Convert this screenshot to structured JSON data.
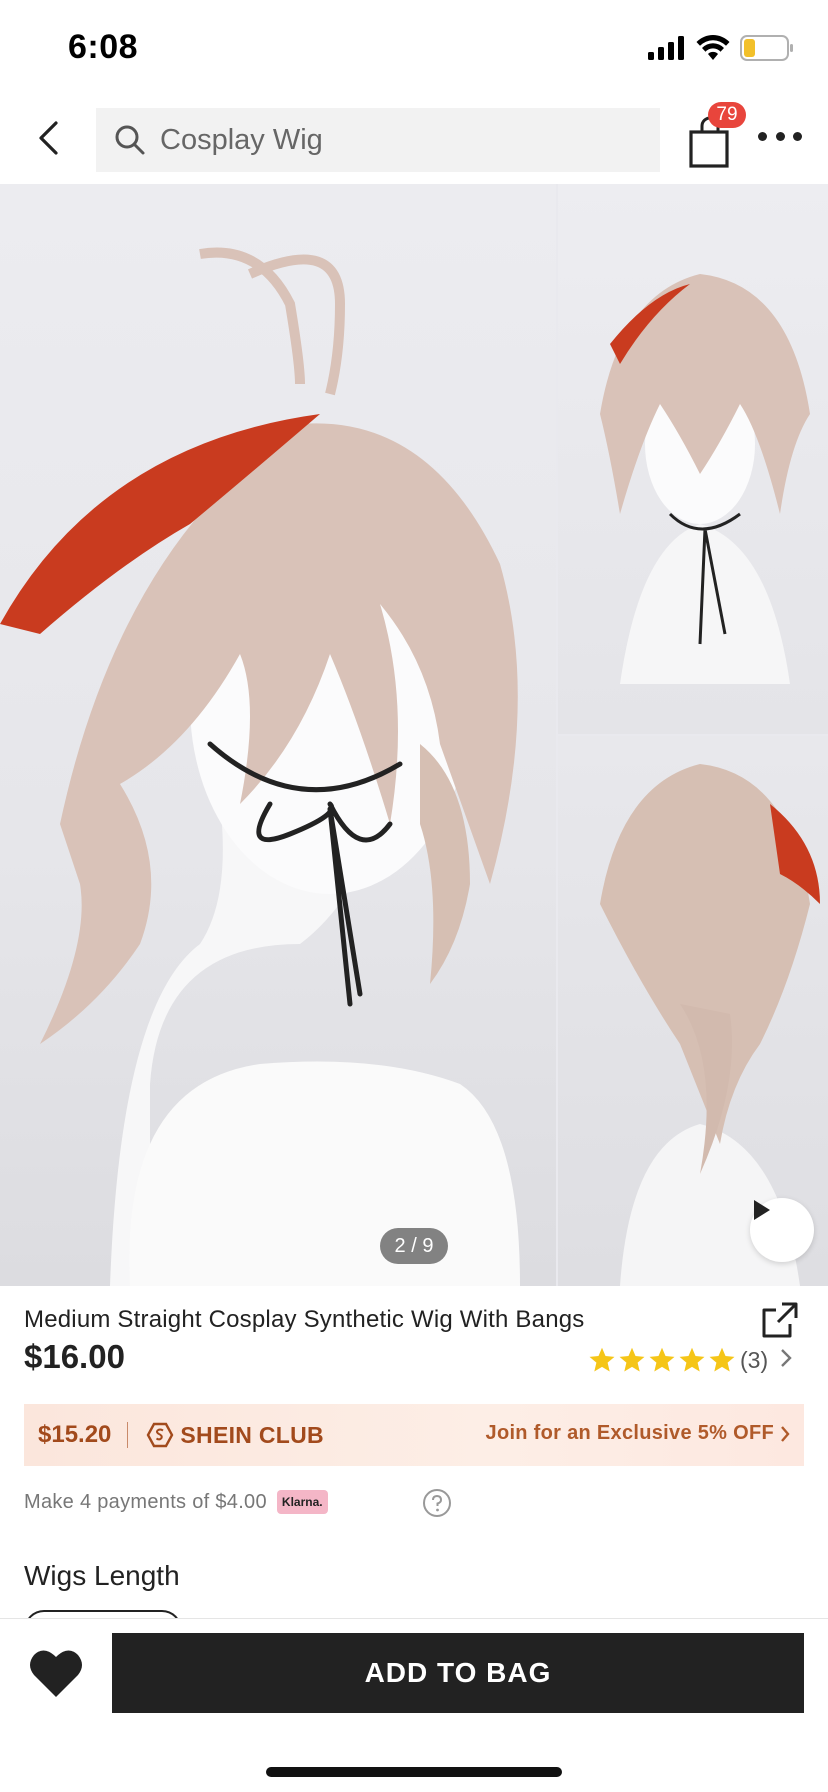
{
  "status_bar": {
    "time": "6:08"
  },
  "nav": {
    "search_text": "Cosplay Wig",
    "cart_count": "79"
  },
  "gallery": {
    "page_indicator": "2 / 9"
  },
  "product": {
    "title": "Medium Straight Cosplay Synthetic Wig With Bangs",
    "price": "$16.00",
    "rating_stars": 5,
    "review_count": "(3)"
  },
  "club": {
    "price": "$15.20",
    "name": "SHEIN CLUB",
    "cta": "Join for an Exclusive 5% OFF"
  },
  "klarna": {
    "text": "Make 4 payments of $4.00",
    "badge": "Klarna."
  },
  "options": {
    "section_title": "Wigs Length"
  },
  "bottom": {
    "add_to_bag": "ADD TO BAG"
  },
  "colors": {
    "accent_dark": "#222222",
    "badge_red": "#e8453c",
    "star_yellow": "#f5c518",
    "club_text": "#a24a1c"
  }
}
